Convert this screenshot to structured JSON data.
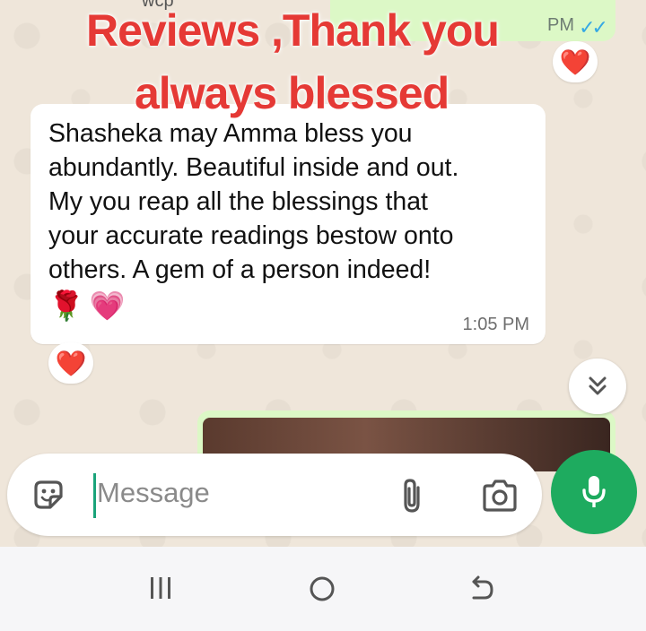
{
  "overlay": {
    "line1": "Reviews ,Thank you",
    "line2": "always blessed"
  },
  "top_message": {
    "partial_text": "wcp",
    "time": "PM",
    "reaction": "❤️"
  },
  "incoming_message": {
    "text": "Shasheka may Amma bless you\nabundantly. Beautiful inside and out.\nMy you reap all the blessings that\nyour accurate readings bestow  onto\nothers. A gem of a person indeed!",
    "emojis": "🌹💗",
    "time": "1:05 PM",
    "reaction": "❤️"
  },
  "composer": {
    "placeholder": "Message"
  },
  "icons": {
    "sticker": "sticker-icon",
    "attach": "paperclip-icon",
    "camera": "camera-icon",
    "mic": "microphone-icon",
    "scroll": "double-chevron-down-icon",
    "nav_menu": "recent-apps-icon",
    "nav_home": "home-icon",
    "nav_back": "back-icon"
  },
  "colors": {
    "overlay_text": "#e53935",
    "outgoing_bubble": "#dcf8c6",
    "send_button": "#1eab5f",
    "read_ticks": "#35a8e4"
  }
}
